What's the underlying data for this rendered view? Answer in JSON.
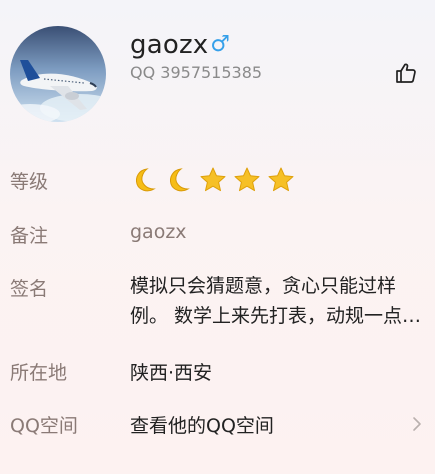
{
  "profile": {
    "name": "gaozx",
    "gender_symbol": "♂",
    "qq_number": "QQ 3957515385",
    "avatar_icon": "airplane-avatar",
    "like_icon": "thumbs-up-icon"
  },
  "rows": {
    "level": {
      "label": "等级",
      "icons": [
        "moon-icon",
        "moon-icon",
        "star-icon",
        "star-icon",
        "star-icon"
      ]
    },
    "remark": {
      "label": "备注",
      "value": "gaozx"
    },
    "signature": {
      "label": "签名",
      "value": "模拟只会猜题意，贪心只能过样例。 数学上来先打表，动规一点也不会。"
    },
    "location": {
      "label": "所在地",
      "value": "陕西·西安"
    },
    "qzone": {
      "label": "QQ空间",
      "value": "查看他的QQ空间",
      "chevron_icon": "chevron-right-icon"
    }
  },
  "colors": {
    "label": "#8a7a76",
    "value": "#222222",
    "gender": "#36a0ea",
    "level_icon": "#f3b60e"
  }
}
